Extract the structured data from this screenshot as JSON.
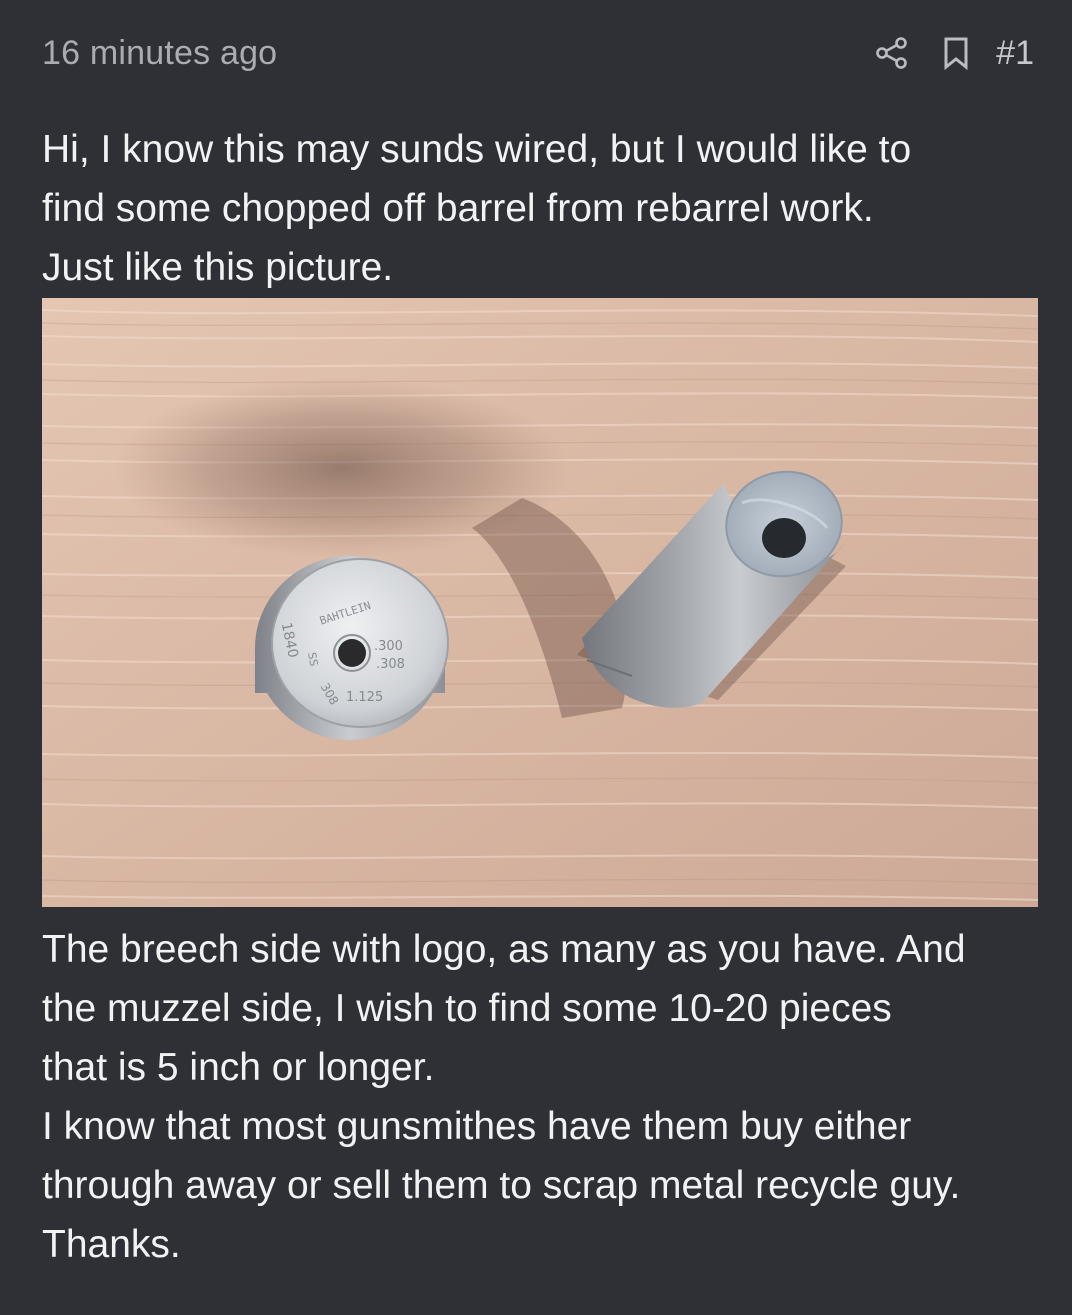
{
  "post": {
    "timestamp": "16 minutes ago",
    "post_number": "#1",
    "icons": {
      "share": "share-icon",
      "bookmark": "bookmark-icon"
    },
    "paragraph1": [
      "Hi, I know this may sunds wired, but I would like to",
      "find some chopped off barrel from rebarrel work.",
      "Just like this picture."
    ],
    "image": {
      "stamp_top": "BAHTLEIN",
      "stamp_300": ".300",
      "stamp_308": ".308",
      "stamp_1125": "1.125",
      "stamp_1840": "1840",
      "stamp_ss": "SS",
      "stamp_308b": "308"
    },
    "paragraph2": [
      "The breech side with logo, as many as you have. And",
      "the muzzel side, I wish to find some 10-20 pieces",
      "that is 5 inch or longer.",
      "I know that most gunsmithes have them buy either",
      "through away or sell them to scrap metal recycle guy.",
      "Thanks."
    ]
  },
  "colors": {
    "background": "#2e3035",
    "text": "#f1f2f4",
    "muted": "#a9adb3",
    "icon": "#b9bcc1"
  }
}
